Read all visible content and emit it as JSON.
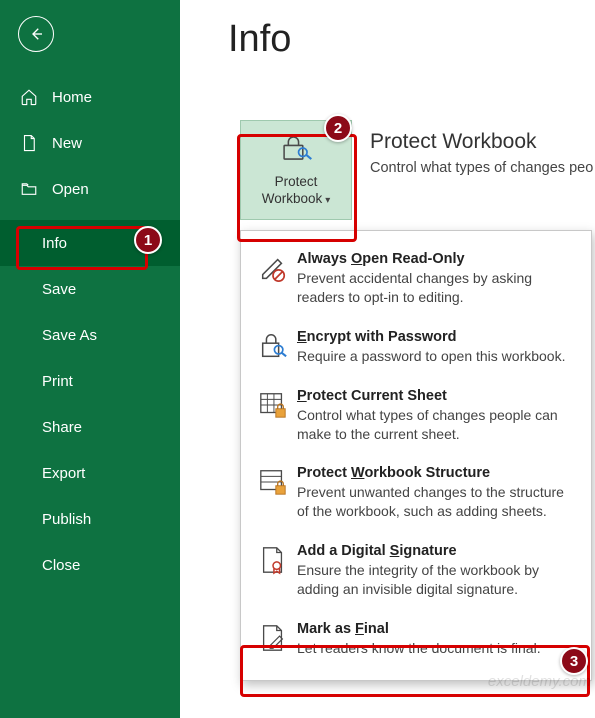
{
  "page": {
    "title": "Info"
  },
  "sidebar": {
    "items": [
      {
        "label": "Home"
      },
      {
        "label": "New"
      },
      {
        "label": "Open"
      },
      {
        "label": "Info"
      },
      {
        "label": "Save"
      },
      {
        "label": "Save As"
      },
      {
        "label": "Print"
      },
      {
        "label": "Share"
      },
      {
        "label": "Export"
      },
      {
        "label": "Publish"
      },
      {
        "label": "Close"
      }
    ]
  },
  "protect_tile": {
    "line1": "Protect",
    "line2": "Workbook"
  },
  "protect_header": {
    "title": "Protect Workbook",
    "sub": "Control what types of changes peo"
  },
  "dropdown": [
    {
      "title_pre": "Always ",
      "title_u": "O",
      "title_post": "pen Read-Only",
      "desc": "Prevent accidental changes by asking readers to opt-in to editing."
    },
    {
      "title_pre": "",
      "title_u": "E",
      "title_post": "ncrypt with Password",
      "desc": "Require a password to open this workbook."
    },
    {
      "title_pre": "",
      "title_u": "P",
      "title_post": "rotect Current Sheet",
      "desc": "Control what types of changes people can make to the current sheet."
    },
    {
      "title_pre": "Protect ",
      "title_u": "W",
      "title_post": "orkbook Structure",
      "desc": "Prevent unwanted changes to the structure of the workbook, such as adding sheets."
    },
    {
      "title_pre": "Add a Digital ",
      "title_u": "S",
      "title_post": "ignature",
      "desc": "Ensure the integrity of the workbook by adding an invisible digital signature."
    },
    {
      "title_pre": "Mark as ",
      "title_u": "F",
      "title_post": "inal",
      "desc": "Let readers know the document is final."
    }
  ],
  "callouts": {
    "c1": "1",
    "c2": "2",
    "c3": "3"
  },
  "watermark": "exceldemy.com"
}
